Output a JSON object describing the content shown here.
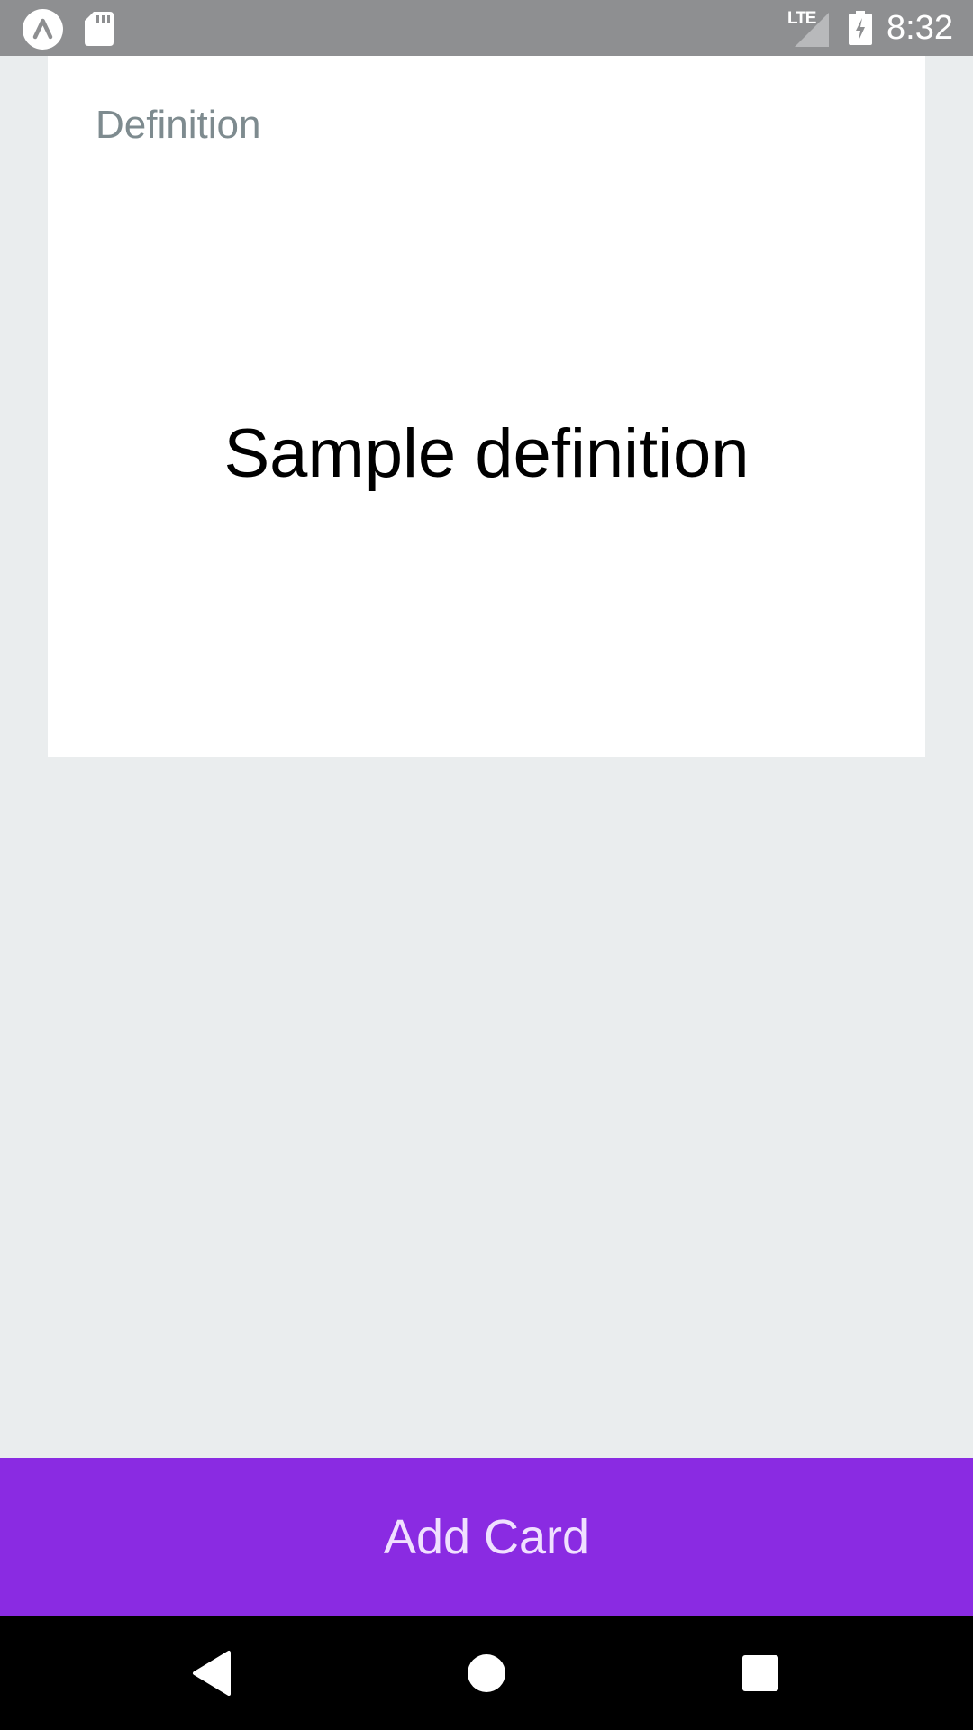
{
  "status_bar": {
    "app_icon": "expo-caret-icon",
    "sd_icon": "sd-card-icon",
    "network_label": "LTE",
    "signal_icon": "cell-signal-icon",
    "battery_icon": "battery-charging-icon",
    "time": "8:32",
    "background_color": "#8e8f91"
  },
  "card": {
    "label": "Definition",
    "content": "Sample definition",
    "background_color": "#ffffff"
  },
  "add_card_button": {
    "label": "Add Card",
    "background_color": "#8a2be2"
  },
  "nav_bar": {
    "back_icon": "back-triangle-icon",
    "home_icon": "home-circle-icon",
    "recents_icon": "recents-square-icon"
  },
  "colors": {
    "page_background": "#eaedee",
    "accent": "#8a2be2"
  }
}
